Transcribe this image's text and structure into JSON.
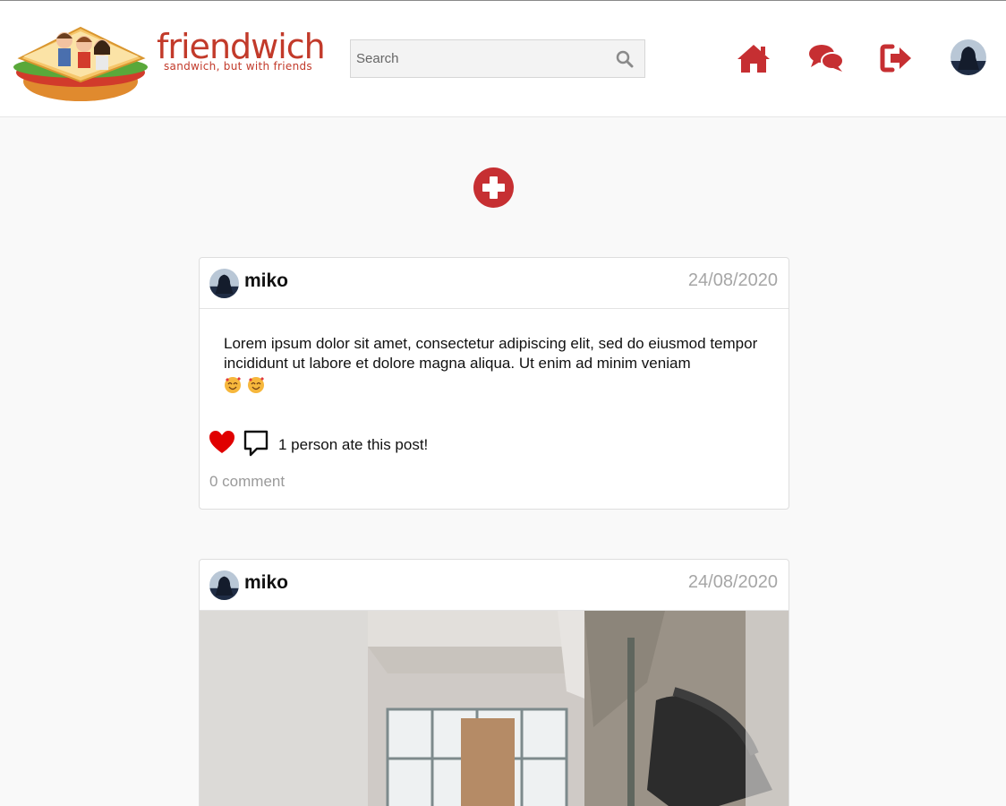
{
  "header": {
    "logo_title": "friendwich",
    "logo_tagline": "sandwich, but with friends",
    "search_placeholder": "Search",
    "icons": {
      "search": "search-icon",
      "home": "home-icon",
      "messages": "chat-bubbles-icon",
      "logout": "sign-out-icon",
      "profile": "avatar"
    }
  },
  "colors": {
    "accent": "#c62f32",
    "heart": "#e00000",
    "date_text": "#a6a6a6"
  },
  "add_post": {
    "icon": "plus-circle-icon"
  },
  "posts": [
    {
      "username": "miko",
      "date": "24/08/2020",
      "text": "Lorem ipsum dolor sit amet, consectetur adipiscing elit, sed do eiusmod tempor incididunt ut labore et dolore magna aliqua. Ut enim ad minim veniam",
      "emojis": [
        "smiling-face-with-hearts-icon",
        "smiling-face-with-hearts-icon"
      ],
      "likes_text": "1 person ate this post!",
      "comments_text": "0 comment"
    },
    {
      "username": "miko",
      "date": "24/08/2020",
      "image": "room-photo"
    }
  ]
}
